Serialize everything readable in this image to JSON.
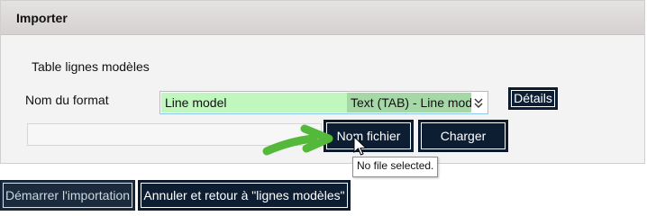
{
  "panel": {
    "title": "Importer",
    "section_title": "Table lignes modèles",
    "format_label": "Nom du format",
    "select": {
      "left_text": "Line model",
      "right_text": "Text (TAB) - Line mod"
    },
    "buttons": {
      "details": "Détails",
      "file_name": "Nom fichier",
      "load": "Charger"
    },
    "tooltip": "No file selected."
  },
  "footer": {
    "start_import": "Démarrer l'importation",
    "cancel_return": "Annuler et retour à \"lignes modèles\""
  },
  "icons": {
    "dropdown": "chevron-down-icon",
    "annotation_arrow": "arrow-right-icon",
    "cursor": "cursor-pointer-icon"
  },
  "colors": {
    "button_bg": "#0d1d32",
    "header_bg": "#ddd8d8",
    "panel_bg": "#f3f3f3",
    "select_left_bg": "#bff7bf",
    "select_right_bg": "#a6d7a6",
    "arrow_green": "#54b83a"
  }
}
